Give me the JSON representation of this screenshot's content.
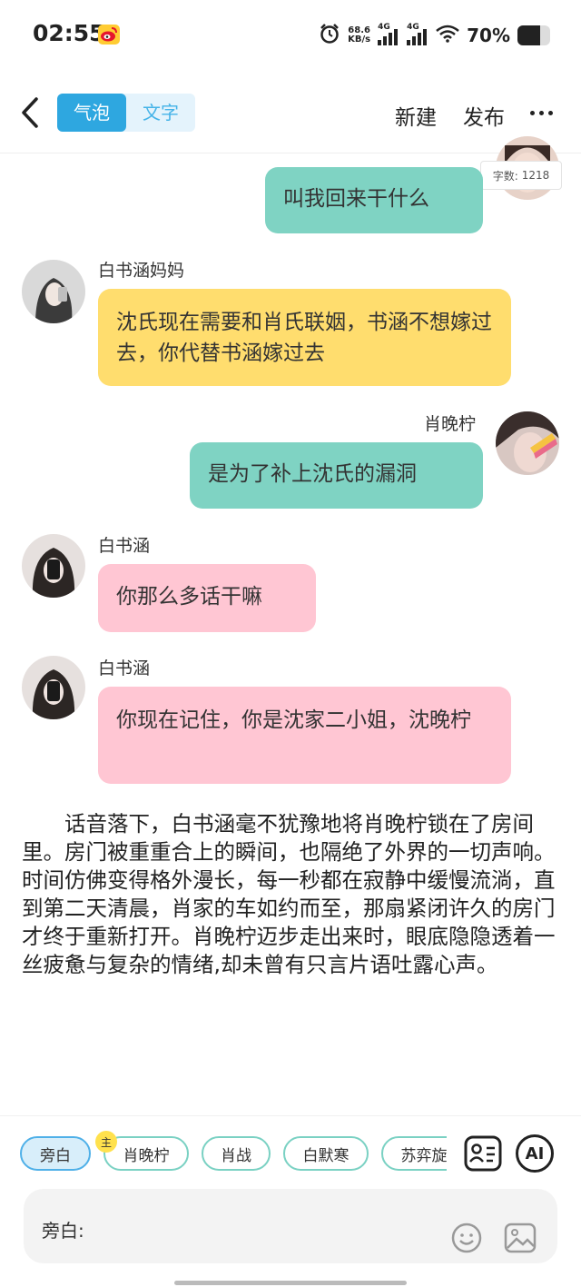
{
  "status_bar": {
    "time": "02:55",
    "net_speed_value": "68.6",
    "net_speed_unit": "KB/s",
    "signal1_label": "4G",
    "signal2_label": "4G",
    "battery_percent": "70%",
    "battery_level": 0.7
  },
  "header": {
    "tab_bubble": "气泡",
    "tab_text": "文字",
    "new_label": "新建",
    "publish_label": "发布"
  },
  "word_count": {
    "label": "字数:",
    "value": "1218"
  },
  "messages": [
    {
      "speaker": "",
      "text": "叫我回来干什么"
    },
    {
      "speaker": "白书涵妈妈",
      "text": "沈氏现在需要和肖氏联姻，书涵不想嫁过去，你代替书涵嫁过去"
    },
    {
      "speaker": "肖晚柠",
      "text": "是为了补上沈氏的漏洞"
    },
    {
      "speaker": "白书涵",
      "text": "你那么多话干嘛"
    },
    {
      "speaker": "白书涵",
      "text": "你现在记住，你是沈家二小姐，沈晚柠"
    }
  ],
  "narration": "话音落下，白书涵毫不犹豫地将肖晚柠锁在了房间里。房门被重重合上的瞬间，也隔绝了外界的一切声响。时间仿佛变得格外漫长，每一秒都在寂静中缓慢流淌，直到第二天清晨，肖家的车如约而至，那扇紧闭许久的房门才终于重新打开。肖晚柠迈步走出来时，眼底隐隐透着一丝疲惫与复杂的情绪,却未曾有只言片语吐露心声。",
  "characters": {
    "main_badge": "主",
    "chips": [
      "旁白",
      "肖晚柠",
      "肖战",
      "白默寒",
      "苏弈旋"
    ]
  },
  "input": {
    "label": "旁白:",
    "ai_label": "AI"
  },
  "colors": {
    "accent": "#2ea7e0",
    "teal_bubble": "#7fd3c3",
    "yellow_bubble": "#ffdd6e",
    "pink_bubble": "#ffc6d3"
  }
}
